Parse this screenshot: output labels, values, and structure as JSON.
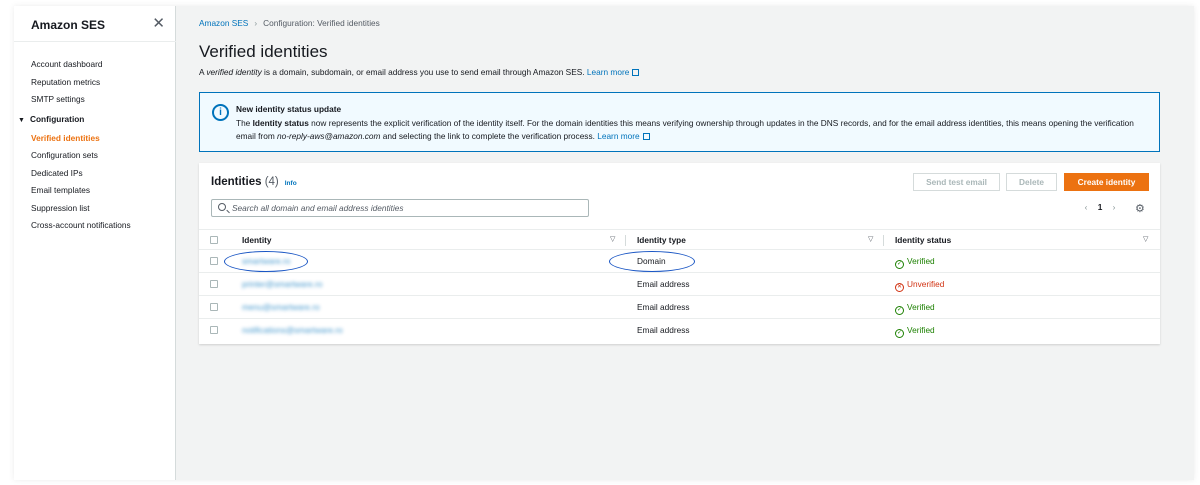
{
  "sidebar": {
    "title": "Amazon SES",
    "items": [
      "Account dashboard",
      "Reputation metrics",
      "SMTP settings"
    ],
    "section": "Configuration",
    "section_items": [
      "Verified identities",
      "Configuration sets",
      "Dedicated IPs",
      "Email templates",
      "Suppression list",
      "Cross-account notifications"
    ],
    "active": "Verified identities"
  },
  "breadcrumb": {
    "root": "Amazon SES",
    "current": "Configuration: Verified identities"
  },
  "page": {
    "title": "Verified identities",
    "desc_pre": "A ",
    "desc_em": "verified identity",
    "desc_post": " is a domain, subdomain, or email address you use to send email through Amazon SES.",
    "learn_more": "Learn more"
  },
  "banner": {
    "title": "New identity status update",
    "body_pre": "The ",
    "body_bold": "Identity status",
    "body_mid": " now represents the explicit verification of the identity itself. For the domain identities this means verifying ownership through updates in the DNS records, and for the email address identities, this means opening the verification email from ",
    "body_em": "no-reply-aws@amazon.com",
    "body_post": " and selecting the link to complete the verification process.",
    "learn_more": "Learn more"
  },
  "panel": {
    "title": "Identities",
    "count": "(4)",
    "info": "Info",
    "send_test": "Send test email",
    "delete": "Delete",
    "create": "Create identity",
    "search_placeholder": "Search all domain and email address identities",
    "page": "1"
  },
  "table": {
    "columns": [
      "Identity",
      "Identity type",
      "Identity status"
    ],
    "rows": [
      {
        "identity": "smartware.ro",
        "type": "Domain",
        "status": "Verified"
      },
      {
        "identity": "printer@smartware.ro",
        "type": "Email address",
        "status": "Unverified"
      },
      {
        "identity": "menu@smartware.ro",
        "type": "Email address",
        "status": "Verified"
      },
      {
        "identity": "notifications@smartware.ro",
        "type": "Email address",
        "status": "Verified"
      }
    ]
  },
  "colors": {
    "accent": "#ec7211",
    "link": "#0073bb",
    "success": "#1d8102",
    "error": "#d13212",
    "annotation": "#1a56c4"
  }
}
